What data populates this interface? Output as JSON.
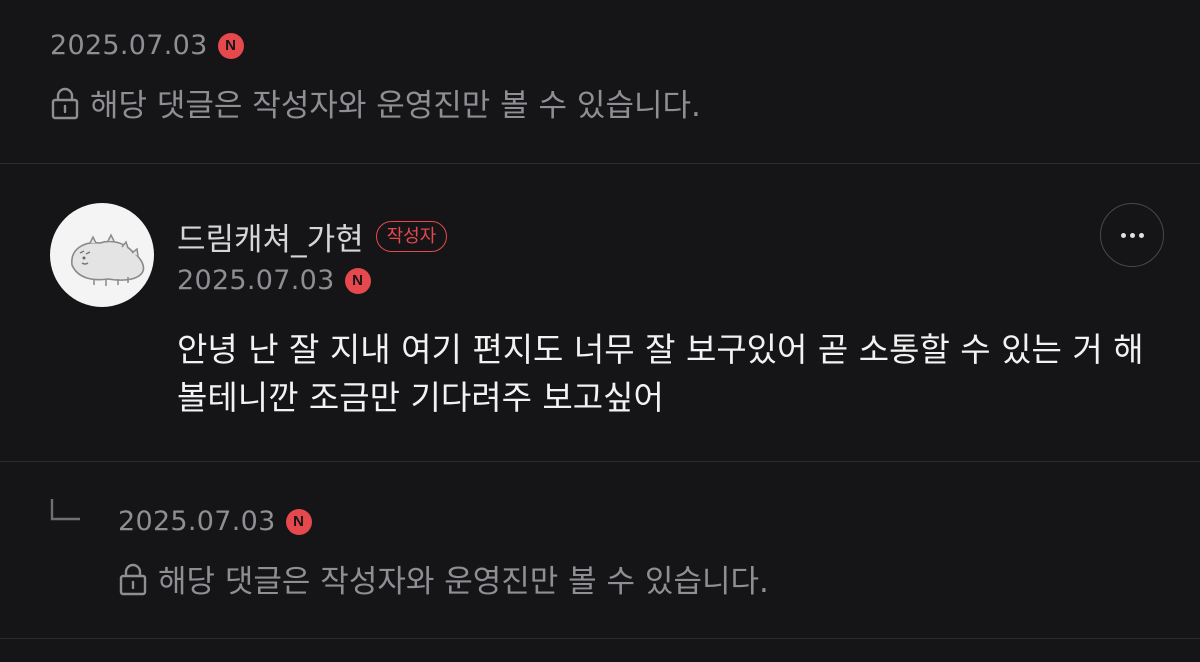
{
  "comments": [
    {
      "date": "2025.07.03",
      "new_badge": "N",
      "private_notice": "해당 댓글은 작성자와 운영진만 볼 수 있습니다."
    },
    {
      "author": "드림캐쳐_가현",
      "author_badge": "작성자",
      "date": "2025.07.03",
      "new_badge": "N",
      "body": "안녕 난 잘 지내 여기 편지도 너무 잘 보구있어 곧 소통할 수 있는 거 해볼테니깐 조금만 기다려주 보고싶어"
    },
    {
      "date": "2025.07.03",
      "new_badge": "N",
      "private_notice": "해당 댓글은 작성자와 운영진만 볼 수 있습니다."
    }
  ],
  "colors": {
    "background": "#151517",
    "accent": "#e5484d",
    "muted_text": "#8e8e93"
  }
}
